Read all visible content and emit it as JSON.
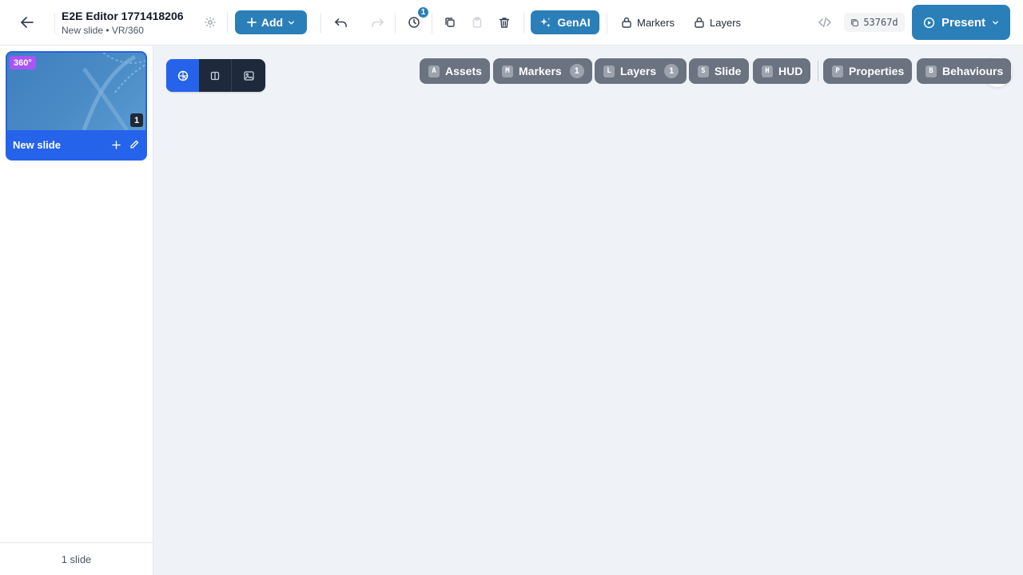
{
  "app": {
    "title": "E2E Editor 1771418206",
    "subtitle": "New slide • VR/360"
  },
  "toolbar": {
    "add_label": "Add",
    "history_count": "1",
    "genai_label": "GenAI",
    "markers_label": "Markers",
    "layers_label": "Layers",
    "hash": "53767d",
    "present_label": "Present"
  },
  "sidebar": {
    "slides": [
      {
        "name": "New slide",
        "badge": "360°",
        "count": "1"
      }
    ],
    "footer": "1 slide"
  },
  "panels": [
    {
      "key": "A",
      "label": "Assets",
      "count": ""
    },
    {
      "key": "M",
      "label": "Markers",
      "count": "1"
    },
    {
      "key": "L",
      "label": "Layers",
      "count": "1"
    },
    {
      "key": "S",
      "label": "Slide",
      "count": ""
    },
    {
      "key": "H",
      "label": "HUD",
      "count": ""
    },
    {
      "key": "P",
      "label": "Properties",
      "count": ""
    },
    {
      "key": "B",
      "label": "Behaviours",
      "count": ""
    }
  ],
  "view_modes": [
    "360-view-icon",
    "split-view-icon",
    "image-view-icon"
  ],
  "colors": {
    "accent": "#2b7fb8",
    "selection": "#2563eb",
    "badge_360": "#a855f7",
    "chip": "#6b7280",
    "canvas": "#eff3f8"
  }
}
